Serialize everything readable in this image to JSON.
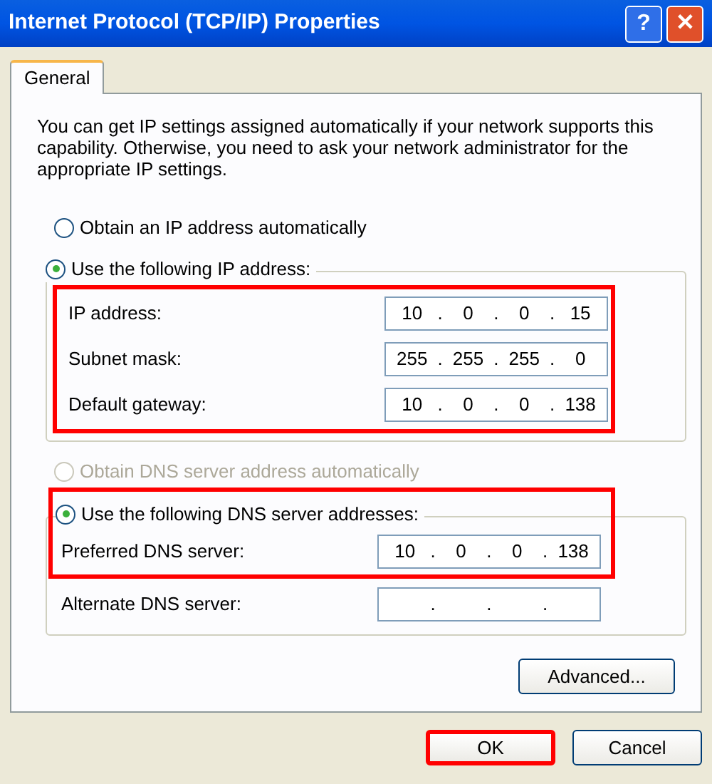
{
  "window": {
    "title": "Internet Protocol (TCP/IP) Properties",
    "buttons": [
      {
        "kind": "help",
        "label": "?"
      },
      {
        "kind": "close",
        "label": "✕"
      }
    ]
  },
  "tabs": [
    {
      "label": "General",
      "selected": true
    }
  ],
  "description": "You can get IP settings assigned automatically if your network supports this capability. Otherwise, you need to ask your network administrator for the appropriate IP settings.",
  "ip_section": {
    "radios": [
      {
        "label": "Obtain an IP address automatically",
        "selected": false,
        "disabled": false
      },
      {
        "label": "Use the following IP address:",
        "selected": true,
        "disabled": false
      }
    ],
    "fields_highlighted": true,
    "fields": [
      {
        "label": "IP address:",
        "value": "10 . 0 . 0 . 15"
      },
      {
        "label": "Subnet mask:",
        "value": "255 . 255 . 255 . 0"
      },
      {
        "label": "Default gateway:",
        "value": "10 . 0 . 0 . 138"
      }
    ]
  },
  "dns_section": {
    "radios": [
      {
        "label": "Obtain DNS server address automatically",
        "selected": false,
        "disabled": true
      },
      {
        "label": "Use the following DNS server addresses:",
        "selected": true,
        "disabled": false
      }
    ],
    "preferred_highlighted": true,
    "fields": [
      {
        "label": "Preferred DNS server:",
        "value": "10 . 0 . 0 . 138"
      },
      {
        "label": "Alternate DNS server:",
        "value": ". . ."
      }
    ]
  },
  "advanced_button": {
    "label": "Advanced..."
  },
  "buttons": [
    {
      "label": "OK",
      "highlighted": true
    },
    {
      "label": "Cancel",
      "highlighted": false
    }
  ]
}
